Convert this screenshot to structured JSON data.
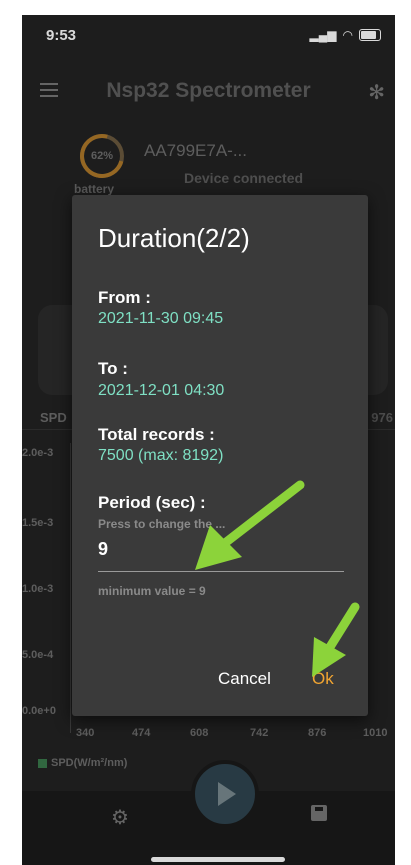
{
  "status_bar": {
    "time": "9:53"
  },
  "app_bar": {
    "title": "Nsp32 Spectrometer"
  },
  "device": {
    "battery_percent": "62%",
    "battery_label": "battery",
    "id": "AA799E7A-...",
    "status": "Device connected"
  },
  "tabs": {
    "spd": "SPD",
    "right": "976"
  },
  "chart": {
    "y_ticks": [
      "2.0e-3",
      "1.5e-3",
      "1.0e-3",
      "5.0e-4",
      "0.0e+0"
    ],
    "x_ticks": [
      "340",
      "474",
      "608",
      "742",
      "876",
      "1010"
    ],
    "legend": "SPD(W/m²/nm)"
  },
  "dialog": {
    "title": "Duration(2/2)",
    "from_label": "From :",
    "from_value": "2021-11-30 09:45",
    "to_label": "To :",
    "to_value": "2021-12-01 04:30",
    "total_label": "Total records :",
    "total_value": "7500 (max: 8192)",
    "period_label": "Period (sec) :",
    "input_hint": "Press to change the ...",
    "input_value": "9",
    "helper_text": "minimum value = 9",
    "cancel_label": "Cancel",
    "ok_label": "Ok"
  },
  "colors": {
    "accent_value": "#7fe0c4",
    "ok_button": "#f2a531",
    "annotation_arrow": "#8cd33a"
  }
}
